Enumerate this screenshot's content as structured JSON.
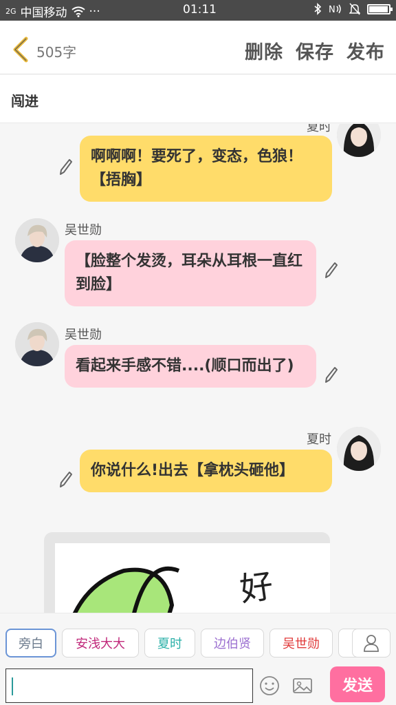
{
  "status_bar": {
    "signal": "2G",
    "carrier": "中国移动",
    "dots": "···",
    "time": "01:11"
  },
  "header": {
    "word_count": "505字",
    "delete_label": "删除",
    "save_label": "保存",
    "publish_label": "发布"
  },
  "title": "闯进",
  "messages": [
    {
      "speaker": "夏时",
      "text": "啊啊啊！要死了，变态，色狼！【捂胸】",
      "side": "right",
      "color": "#ffdc6a"
    },
    {
      "speaker": "吴世勋",
      "text": "【脸整个发烫，耳朵从耳根一直红到脸】",
      "side": "left",
      "color": "#ffd2dc"
    },
    {
      "speaker": "吴世勋",
      "text": "看起来手感不错....(顺口而出了)",
      "side": "left",
      "color": "#ffd2dc"
    },
    {
      "speaker": "夏时",
      "text": "你说什么!出去【拿枕头砸他】",
      "side": "right",
      "color": "#ffdc6a"
    }
  ],
  "image_text": "好",
  "roles": [
    {
      "label": "旁白",
      "color": "#6b7a8c",
      "active": true
    },
    {
      "label": "安浅大大",
      "color": "#c0287a",
      "active": false
    },
    {
      "label": "夏时",
      "color": "#2bb0a8",
      "active": false
    },
    {
      "label": "边伯贤",
      "color": "#9b6fd0",
      "active": false
    },
    {
      "label": "吴世勋",
      "color": "#e03a3a",
      "active": false
    }
  ],
  "input": {
    "placeholder": "",
    "send_label": "发送"
  },
  "icons": {
    "back": "chevron-left-icon",
    "emoji": "emoji-icon",
    "image": "image-icon",
    "profile": "person-icon",
    "edit": "pencil-icon"
  }
}
